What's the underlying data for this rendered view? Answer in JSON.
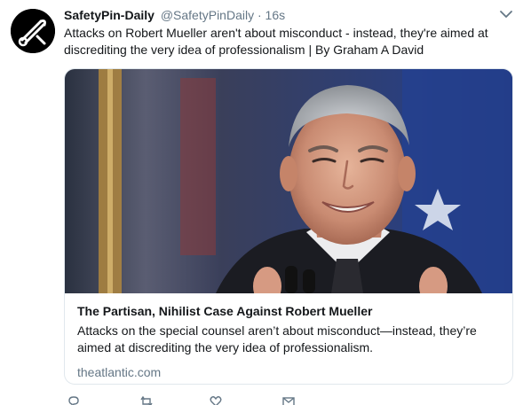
{
  "tweet": {
    "display_name": "SafetyPin-Daily",
    "handle": "@SafetyPinDaily",
    "separator": "·",
    "timestamp": "16s",
    "text": "Attacks on Robert Mueller aren't about misconduct - instead, they're aimed at discrediting the very idea of professionalism  | By Graham A David",
    "avatar_icon": "safety-pin-logo-icon",
    "menu_icon": "chevron-down-icon"
  },
  "card": {
    "title": "The Partisan, Nihilist Case Against Robert Mueller",
    "description": "Attacks on the special counsel aren’t about misconduct—instead, they’re aimed at discrediting the very idea of professionalism.",
    "domain": "theatlantic.com",
    "image_subject": "photo-smiling-man-flags"
  },
  "actions": [
    "reply-icon",
    "retweet-icon",
    "like-icon",
    "message-icon"
  ],
  "colors": {
    "text": "#14171a",
    "secondary": "#657786",
    "border": "#e1e8ed"
  }
}
